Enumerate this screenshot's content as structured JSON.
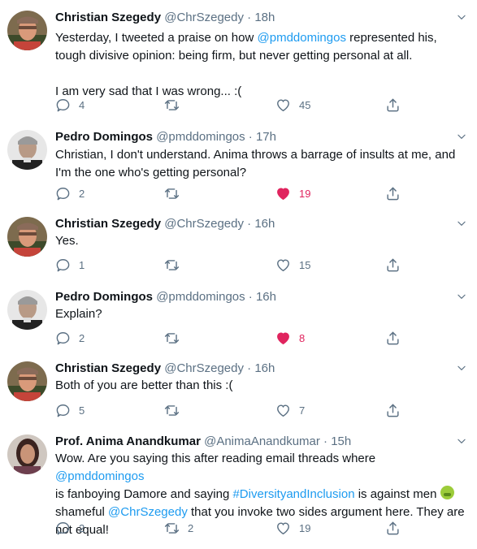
{
  "theme": {
    "link_color": "#1d9bf0",
    "like_color": "#e0245e",
    "muted_color": "#5b7083"
  },
  "tweets": [
    {
      "name": "Christian Szegedy",
      "handle": "@ChrSzegedy · 18h",
      "body": [
        [
          {
            "t": "Yesterday, I tweeted a praise on how "
          },
          {
            "t": "@pmddomingos",
            "link": true
          },
          {
            "t": " represented his,"
          }
        ],
        [
          {
            "t": "tough divisive opinion: being firm, but never getting personal at all."
          }
        ],
        [],
        [
          {
            "t": "I am very sad that I was wrong... :("
          }
        ]
      ],
      "replies": "4",
      "retweets": "",
      "likes": "45",
      "liked": false
    },
    {
      "name": "Pedro Domingos",
      "handle": "@pmddomingos · 17h",
      "body": [
        [
          {
            "t": "Christian, I don't understand. Anima throws a barrage of insults at me, and"
          }
        ],
        [
          {
            "t": "I'm the one who's getting personal?"
          }
        ]
      ],
      "replies": "2",
      "retweets": "",
      "likes": "19",
      "liked": true
    },
    {
      "name": "Christian Szegedy",
      "handle": "@ChrSzegedy · 16h",
      "body": [
        [
          {
            "t": "Yes."
          }
        ]
      ],
      "replies": "1",
      "retweets": "",
      "likes": "15",
      "liked": false
    },
    {
      "name": "Pedro Domingos",
      "handle": "@pmddomingos · 16h",
      "body": [
        [
          {
            "t": "Explain?"
          }
        ]
      ],
      "replies": "2",
      "retweets": "",
      "likes": "8",
      "liked": true
    },
    {
      "name": "Christian Szegedy",
      "handle": "@ChrSzegedy · 16h",
      "body": [
        [
          {
            "t": "Both of you are better than this :("
          }
        ]
      ],
      "replies": "5",
      "retweets": "",
      "likes": "7",
      "liked": false
    },
    {
      "name": "Prof. Anima Anandkumar",
      "handle": "@AnimaAnandkumar · 15h",
      "body": [
        [
          {
            "t": "Wow. Are you saying this after reading email threads where "
          },
          {
            "t": "@pmddomingos",
            "link": true
          }
        ],
        [
          {
            "t": "is fanboying Damore and saying "
          },
          {
            "t": "#DiversityandInclusion",
            "link": true
          },
          {
            "t": " is against men "
          },
          {
            "emoji": "nauseated-face-emoji"
          }
        ],
        [
          {
            "t": "shameful "
          },
          {
            "t": "@ChrSzegedy",
            "link": true
          },
          {
            "t": " that you invoke two sides argument here. They are"
          }
        ],
        [
          {
            "t": "not equal!"
          }
        ]
      ],
      "replies": "2",
      "retweets": "2",
      "likes": "19",
      "liked": false
    }
  ]
}
